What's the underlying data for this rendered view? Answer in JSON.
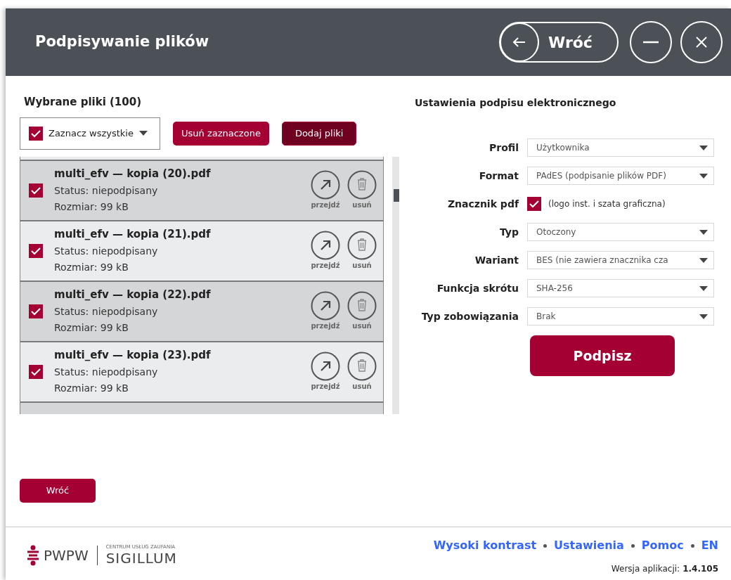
{
  "header": {
    "title": "Podpisywanie plików",
    "back_button": "Wróć"
  },
  "files_panel": {
    "title": "Wybrane pliki (100)",
    "select_all": {
      "label": "Zaznacz wszystkie",
      "checked": true
    },
    "remove_selected": "Usuń zaznaczone",
    "add_files": "Dodaj pliki",
    "files": [
      {
        "name": "multi_efv — kopia (20).pdf",
        "status": "Status: niepodpisany",
        "size": "Rozmiar: 99 kB",
        "checked": true,
        "go_label": "przejdź",
        "delete_label": "usuń"
      },
      {
        "name": "multi_efv — kopia (21).pdf",
        "status": "Status: niepodpisany",
        "size": "Rozmiar: 99 kB",
        "checked": true,
        "go_label": "przejdź",
        "delete_label": "usuń"
      },
      {
        "name": "multi_efv — kopia (22).pdf",
        "status": "Status: niepodpisany",
        "size": "Rozmiar: 99 kB",
        "checked": true,
        "go_label": "przejdź",
        "delete_label": "usuń"
      },
      {
        "name": "multi_efv — kopia (23).pdf",
        "status": "Status: niepodpisany",
        "size": "Rozmiar: 99 kB",
        "checked": true,
        "go_label": "przejdź",
        "delete_label": "usuń"
      }
    ],
    "back_button": "Wróć"
  },
  "settings": {
    "title": "Ustawienia podpisu elektronicznego",
    "fields": [
      {
        "kind": "select",
        "label": "Profil",
        "value": "Użytkownika"
      },
      {
        "kind": "select",
        "label": "Format",
        "value": "PAdES (podpisanie plików PDF)"
      },
      {
        "kind": "checkbox",
        "label": "Znacznik pdf",
        "value": "(logo inst. i szata graficzna)",
        "checked": true
      },
      {
        "kind": "select",
        "label": "Typ",
        "value": "Otoczony"
      },
      {
        "kind": "select",
        "label": "Wariant",
        "value": "BES (nie zawiera znacznika cza"
      },
      {
        "kind": "select",
        "label": "Funkcja skrótu",
        "value": "SHA-256"
      },
      {
        "kind": "select",
        "label": "Typ zobowiązania",
        "value": "Brak"
      }
    ],
    "sign_button": "Podpisz"
  },
  "footer": {
    "logo": {
      "brand": "PWPW",
      "tagline": "CENTRUM USŁUG ZAUFANIA",
      "product": "SIGILLUM"
    },
    "links": [
      "Wysoki kontrast",
      "Ustawienia",
      "Pomoc",
      "EN"
    ],
    "version_label": "Wersja aplikacji:",
    "version": "1.4.105"
  }
}
